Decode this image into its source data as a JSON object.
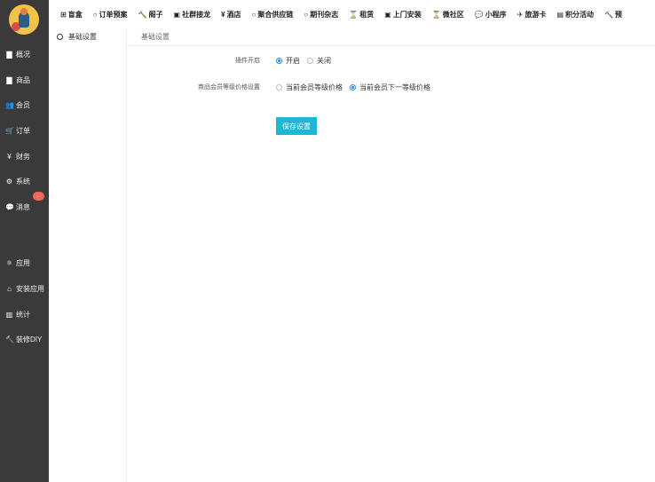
{
  "sidebar": {
    "items": [
      {
        "icon": "▇",
        "label": "概况"
      },
      {
        "icon": "▇",
        "label": "商品"
      },
      {
        "icon": "👥",
        "label": "会员"
      },
      {
        "icon": "🛒",
        "label": "订单"
      },
      {
        "icon": "¥",
        "label": "财务"
      },
      {
        "icon": "⚙",
        "label": "系统"
      },
      {
        "icon": "💬",
        "label": "消息",
        "badge": "..."
      },
      {
        "icon": "⚛",
        "label": "应用"
      },
      {
        "icon": "⌂",
        "label": "安装应用"
      },
      {
        "icon": "▥",
        "label": "统计"
      },
      {
        "icon": "🔨",
        "label": "装修DIY"
      }
    ]
  },
  "topnav": {
    "items": [
      {
        "icon": "⊞",
        "label": "盲盒"
      },
      {
        "icon": "○",
        "label": "订单预案"
      },
      {
        "icon": "🔨",
        "label": "阁子"
      },
      {
        "icon": "▣",
        "label": "社群接龙"
      },
      {
        "icon": "¥",
        "label": "酒店"
      },
      {
        "icon": "○",
        "label": "聚合供应链"
      },
      {
        "icon": "○",
        "label": "期刊杂志"
      },
      {
        "icon": "⌛",
        "label": "租赁"
      },
      {
        "icon": "▣",
        "label": "上门安装"
      },
      {
        "icon": "⌛",
        "label": "微社区"
      },
      {
        "icon": "💬",
        "label": "小程序"
      },
      {
        "icon": "✈",
        "label": "旅游卡"
      },
      {
        "icon": "▤",
        "label": "积分活动"
      },
      {
        "icon": "🔨",
        "label": "预"
      }
    ]
  },
  "subnav": {
    "item": "基础设置"
  },
  "main": {
    "breadcrumb": "基础设置",
    "plugin_switch": {
      "label": "插件开启",
      "options": [
        "开启",
        "关闭"
      ],
      "selected": "开启"
    },
    "member_price": {
      "label": "商品会员等级价格设置",
      "options": [
        "当前会员等级价格",
        "当前会员下一等级价格"
      ],
      "selected": "当前会员下一等级价格"
    },
    "save_label": "保存设置"
  },
  "colors": {
    "sidebar_bg": "#3a3a3a",
    "accent": "#1cb7d3",
    "radio_selected": "#1e88e5",
    "badge": "#f3645c"
  }
}
